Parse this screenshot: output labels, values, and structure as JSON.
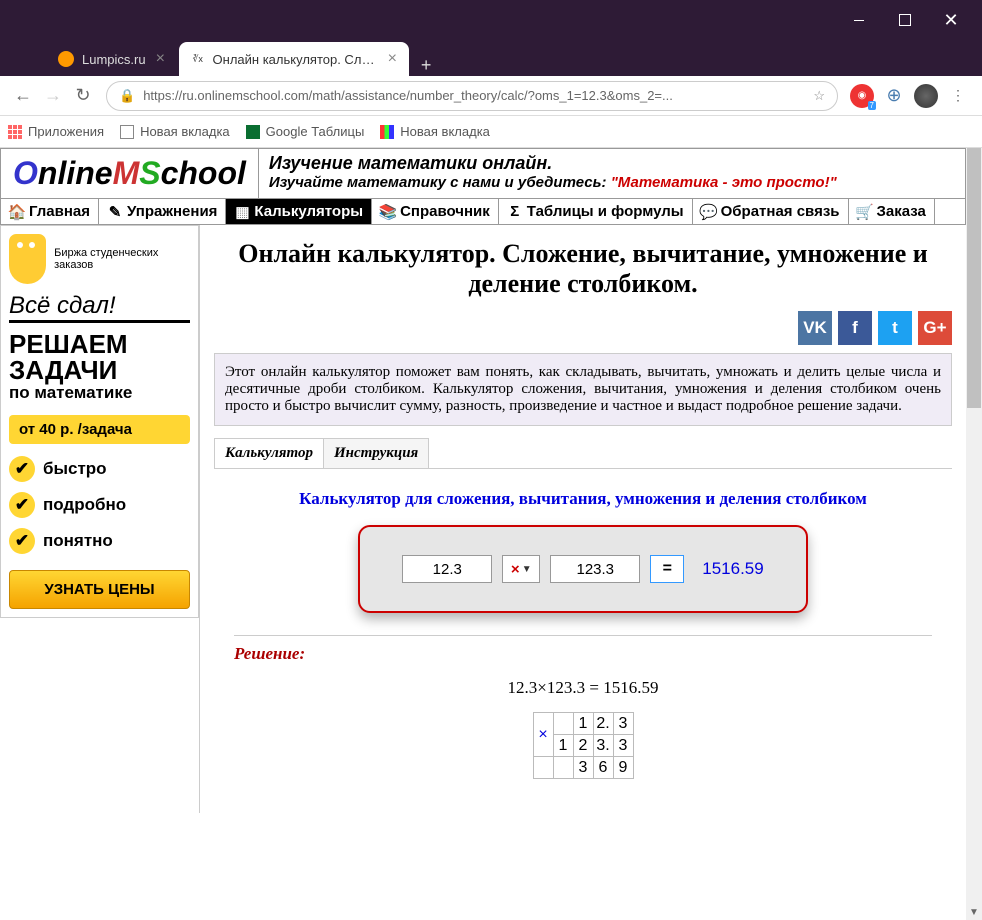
{
  "window_controls": {
    "close": "✕"
  },
  "tabs": [
    {
      "label": "Lumpics.ru"
    },
    {
      "label": "Онлайн калькулятор. Сложение",
      "favicon_text": "∛x"
    }
  ],
  "new_tab": "+",
  "address_bar": {
    "url": "https://ru.onlinemschool.com/math/assistance/number_theory/calc/?oms_1=12.3&oms_2=...",
    "shield_badge": "7"
  },
  "bookmarks": {
    "apps": "Приложения",
    "b1": "Новая вкладка",
    "b2": "Google Таблицы",
    "b3": "Новая вкладка"
  },
  "logo": {
    "o": "O",
    "nline": "nline",
    "m": "M",
    "s": "S",
    "chool": "chool"
  },
  "tagline": {
    "line1": "Изучение математики онлайн.",
    "line2_prefix": "Изучайте математику с нами и убедитесь: ",
    "motto": "\"Математика - это просто!\""
  },
  "nav": {
    "home": "Главная",
    "exercises": "Упражнения",
    "calculators": "Калькуляторы",
    "reference": "Справочник",
    "tables": "Таблицы и формулы",
    "feedback": "Обратная связь",
    "order": "Заказа"
  },
  "sidebar": {
    "ad1": {
      "tagline": "Биржа студенческих заказов",
      "brand": "Всё сдал!"
    },
    "ad2": {
      "line1": "РЕШАЕМ",
      "line2": "ЗАДАЧИ",
      "line3": "по математике"
    },
    "price": "от 40 р. /задача",
    "features": [
      "быстро",
      "подробно",
      "понятно"
    ],
    "cta": "УЗНАТЬ ЦЕНЫ"
  },
  "page_title": "Онлайн калькулятор. Сложение, вычитание, умножение и деление столбиком.",
  "social": {
    "vk": "VK",
    "fb": "f",
    "tw": "t",
    "gp": "G+"
  },
  "intro": "Этот онлайн калькулятор поможет вам понять, как складывать, вычитать, умножать и делить целые числа и десятичные дроби столбиком. Калькулятор сложения, вычитания, умножения и деления столбиком очень просто и быстро вычислит сумму, разность, произведение и частное и выдаст подробное решение задачи.",
  "content_tabs": {
    "calc": "Калькулятор",
    "instr": "Инструкция"
  },
  "calculator": {
    "title": "Калькулятор для сложения, вычитания, умножения и деления столбиком",
    "input1": "12.3",
    "operator": "×",
    "input2": "123.3",
    "equals": "=",
    "result": "1516.59"
  },
  "solution": {
    "label": "Решение:",
    "equation": "12.3×123.3 = 1516.59",
    "grid": {
      "op": "×",
      "row1": [
        "",
        "1",
        "2.",
        "3"
      ],
      "row2": [
        "1",
        "2",
        "3.",
        "3"
      ],
      "row3": [
        "",
        "3",
        "6",
        "9"
      ]
    }
  }
}
